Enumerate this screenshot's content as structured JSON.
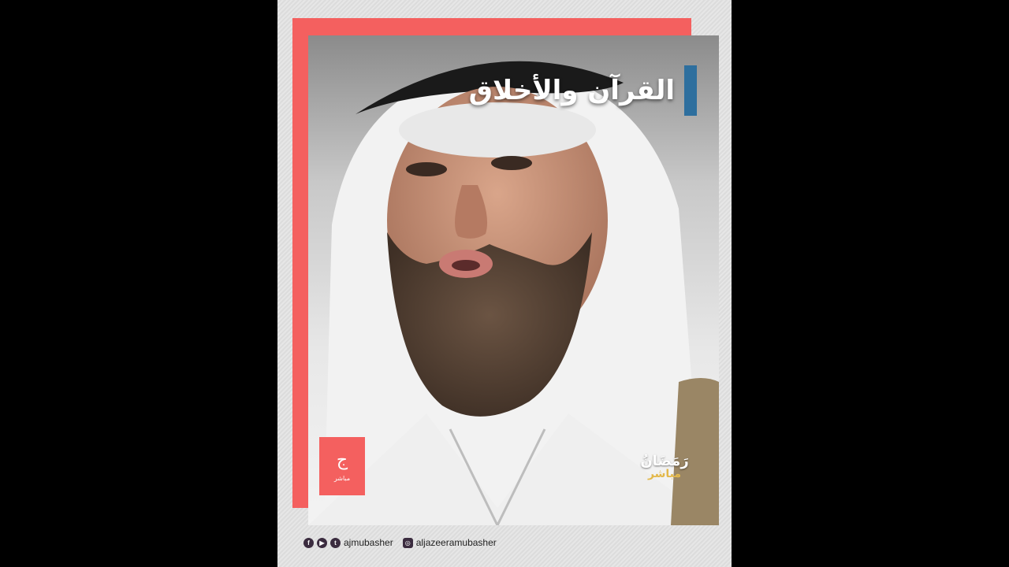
{
  "title": "القرآن والأخلاق",
  "logo_left": {
    "mark": "ج",
    "sub": "مباشر"
  },
  "logo_right": {
    "ramadan": "رَمَضَانُ",
    "mubasher": "مباشر"
  },
  "social": {
    "handle_primary": "ajmubasher",
    "handle_secondary": "aljazeeramubasher",
    "icons": [
      "facebook-icon",
      "youtube-icon",
      "twitter-icon",
      "instagram-icon"
    ]
  },
  "colors": {
    "accent_red": "#f4605f",
    "title_bar": "#2e6f9e",
    "mubasher_gold": "#e3b84a"
  }
}
